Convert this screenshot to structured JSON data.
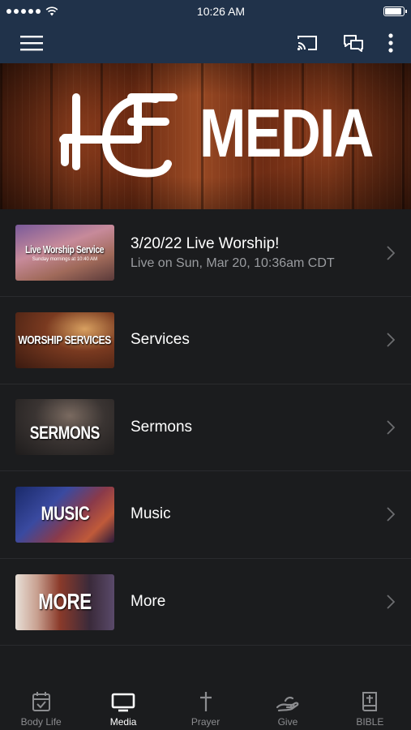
{
  "status_bar": {
    "time": "10:26 AM"
  },
  "banner": {
    "title": "MEDIA"
  },
  "items": [
    {
      "title": "3/20/22 Live Worship!",
      "subtitle": "Live on Sun, Mar 20, 10:36am CDT",
      "thumb_title": "Live Worship Service",
      "thumb_sub": "Sunday mornings at 10:40 AM"
    },
    {
      "title": "Services",
      "thumb_title": "WORSHIP SERVICES"
    },
    {
      "title": "Sermons",
      "thumb_title": "SERMONS"
    },
    {
      "title": "Music",
      "thumb_title": "MUSIC"
    },
    {
      "title": "More",
      "thumb_title": "MORE"
    }
  ],
  "tabs": [
    {
      "label": "Body Life",
      "icon": "calendar-check-icon"
    },
    {
      "label": "Media",
      "icon": "tv-icon",
      "active": true
    },
    {
      "label": "Prayer",
      "icon": "cross-icon"
    },
    {
      "label": "Give",
      "icon": "giving-hand-icon"
    },
    {
      "label": "BIBLE",
      "icon": "bible-icon"
    }
  ],
  "colors": {
    "header_bg": "#20324a",
    "body_bg": "#1b1c1e",
    "subtitle": "#9a9ca0",
    "tab_inactive": "#8c8d90"
  }
}
